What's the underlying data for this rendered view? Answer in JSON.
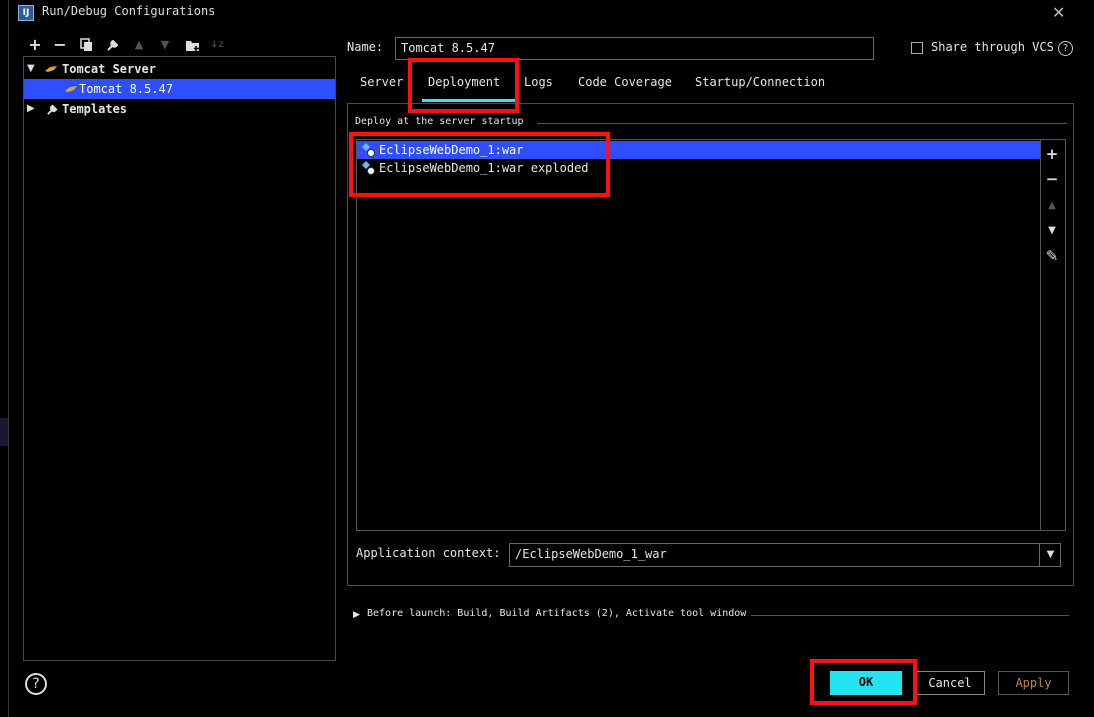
{
  "window": {
    "title": "Run/Debug Configurations",
    "app_icon_text": "IJ",
    "close_glyph": "✕"
  },
  "toolbar": {
    "add": "+",
    "remove": "−",
    "copy": "⧉",
    "settings": "🔧",
    "move_up": "▲",
    "move_down": "▼",
    "new_folder": "📁",
    "sort": "↓z"
  },
  "tree": {
    "items": [
      {
        "label": "Tomcat Server",
        "expanded": true,
        "bold": true
      },
      {
        "label": "Tomcat 8.5.47",
        "selected": true
      },
      {
        "label": "Templates",
        "expanded": false,
        "bold": true
      }
    ]
  },
  "form": {
    "name_label": "Name:",
    "name_value": "Tomcat 8.5.47",
    "share_label": "Share through VCS",
    "share_checked": false,
    "help_glyph": "?"
  },
  "tabs": [
    {
      "label": "Server"
    },
    {
      "label": "Deployment",
      "active": true
    },
    {
      "label": "Logs"
    },
    {
      "label": "Code Coverage"
    },
    {
      "label": "Startup/Connection"
    }
  ],
  "deployment": {
    "section_label": "Deploy at the server startup",
    "artifacts": [
      {
        "label": "EclipseWebDemo_1:war",
        "selected": true
      },
      {
        "label": "EclipseWebDemo_1:war exploded",
        "selected": false
      }
    ],
    "side_tools": {
      "add": "+",
      "remove": "−",
      "up": "▲",
      "down": "▼",
      "edit": "✎"
    },
    "context_label": "Application context:",
    "context_value": "/EclipseWebDemo_1_war"
  },
  "before_launch": {
    "text": "Before launch: Build, Build Artifacts (2), Activate tool window"
  },
  "buttons": {
    "ok": "OK",
    "cancel": "Cancel",
    "apply": "Apply",
    "help": "?"
  },
  "colors": {
    "selection": "#2f4eff",
    "accent": "#2ee6ff",
    "ok_button": "#22e3f2",
    "annotation": "#ff1111",
    "apply_text": "#b7873a"
  }
}
